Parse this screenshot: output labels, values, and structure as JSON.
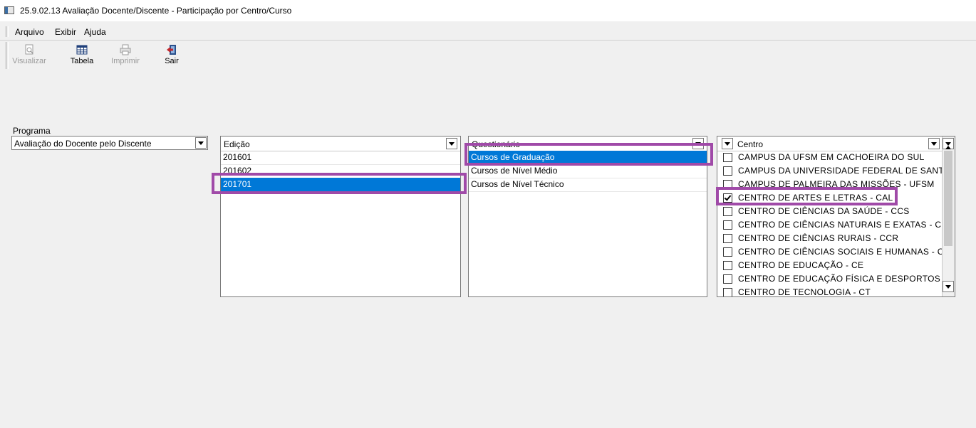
{
  "window": {
    "title": "25.9.02.13 Avaliação Docente/Discente - Participação por Centro/Curso"
  },
  "menu": {
    "items": [
      "Arquivo",
      "Exibir",
      "Ajuda"
    ]
  },
  "toolbar": {
    "visualizar": "Visualizar",
    "tabela": "Tabela",
    "imprimir": "Imprimir",
    "sair": "Sair"
  },
  "programa": {
    "label": "Programa",
    "value": "Avaliação do Docente pelo Discente"
  },
  "edicao": {
    "header": "Edição",
    "rows": [
      "201601",
      "201602",
      "201701"
    ],
    "selected": "201701"
  },
  "questionario": {
    "header": "Questionário",
    "rows": [
      "Cursos de Graduação",
      "Cursos de Nível Médio",
      "Cursos de Nível Técnico"
    ],
    "selected": "Cursos de Graduação"
  },
  "centro": {
    "header": "Centro",
    "rows": [
      {
        "label": "CAMPUS DA UFSM EM CACHOEIRA DO SUL",
        "checked": false
      },
      {
        "label": "CAMPUS DA UNIVERSIDADE FEDERAL DE SANTA",
        "checked": false
      },
      {
        "label": "CAMPUS DE PALMEIRA DAS MISSÕES - UFSM",
        "checked": false
      },
      {
        "label": "CENTRO DE ARTES E LETRAS - CAL",
        "checked": true
      },
      {
        "label": "CENTRO DE CIÊNCIAS DA SAÚDE - CCS",
        "checked": false
      },
      {
        "label": "CENTRO DE CIÊNCIAS NATURAIS E EXATAS - CC",
        "checked": false
      },
      {
        "label": "CENTRO DE CIÊNCIAS RURAIS - CCR",
        "checked": false
      },
      {
        "label": "CENTRO DE CIÊNCIAS SOCIAIS E HUMANAS - CC",
        "checked": false
      },
      {
        "label": "CENTRO DE EDUCAÇÃO - CE",
        "checked": false
      },
      {
        "label": "CENTRO DE EDUCAÇÃO FÍSICA E DESPORTOS - I",
        "checked": false
      },
      {
        "label": "CENTRO DE TECNOLOGIA - CT",
        "checked": false
      }
    ]
  },
  "colors": {
    "selection": "#0078d7",
    "highlight": "#a04aa8"
  }
}
